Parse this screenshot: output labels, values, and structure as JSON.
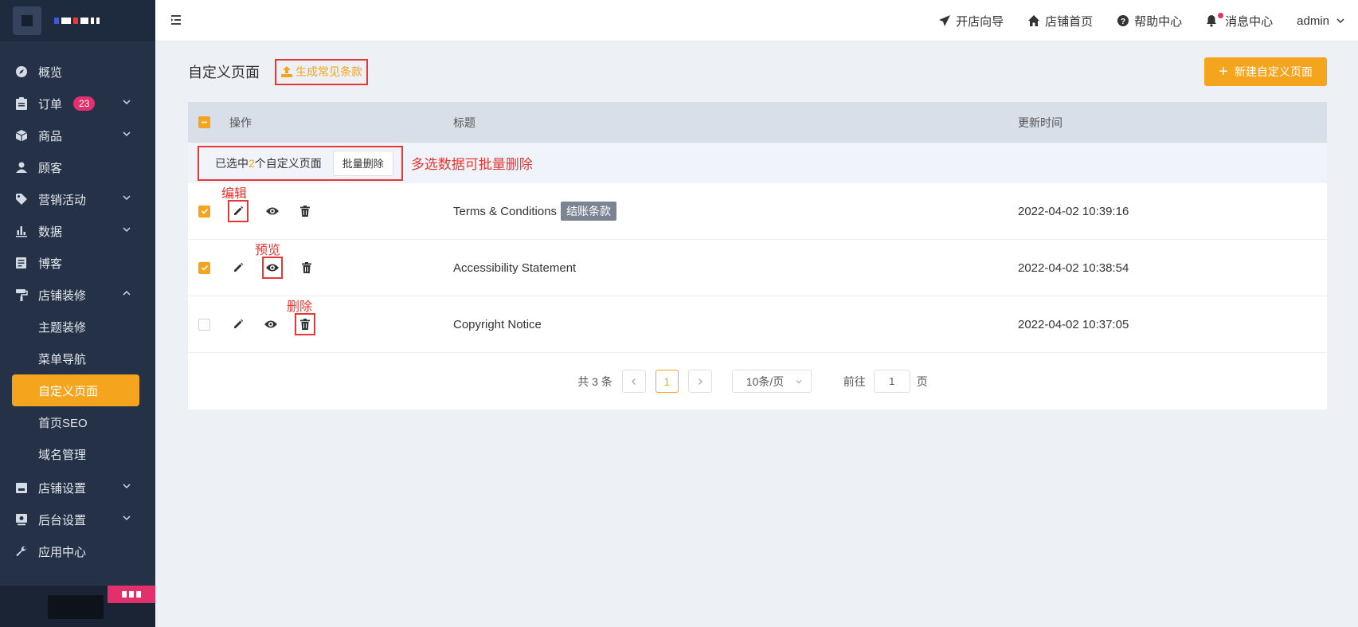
{
  "topbar": {
    "links": [
      {
        "label": "开店向导",
        "icon": "paper-plane-icon"
      },
      {
        "label": "店铺首页",
        "icon": "home-icon"
      },
      {
        "label": "帮助中心",
        "icon": "help-circle-icon"
      },
      {
        "label": "消息中心",
        "icon": "bell-icon"
      }
    ],
    "user": "admin"
  },
  "sidebar": {
    "items": [
      {
        "label": "概览",
        "icon": "compass-icon"
      },
      {
        "label": "订单",
        "icon": "clipboard-icon",
        "badge": "23"
      },
      {
        "label": "商品",
        "icon": "box-icon"
      },
      {
        "label": "顾客",
        "icon": "user-icon"
      },
      {
        "label": "营销活动",
        "icon": "tag-icon"
      },
      {
        "label": "数据",
        "icon": "bar-chart-icon"
      },
      {
        "label": "博客",
        "icon": "blog-icon"
      },
      {
        "label": "店铺装修",
        "icon": "paint-roller-icon"
      },
      {
        "label": "店铺设置",
        "icon": "store-icon"
      },
      {
        "label": "后台设置",
        "icon": "monitor-icon"
      },
      {
        "label": "应用中心",
        "icon": "wrench-icon"
      }
    ],
    "sub_items": [
      "主题装修",
      "菜单导航",
      "自定义页面",
      "首页SEO",
      "域名管理"
    ]
  },
  "page": {
    "title": "自定义页面",
    "generate_button": "生成常见条款",
    "new_button": "新建自定义页面"
  },
  "table": {
    "headers": {
      "op": "操作",
      "title": "标题",
      "time": "更新时间"
    },
    "bulk": {
      "prefix": "已选中",
      "count": "2",
      "suffix": "个自定义页面",
      "delete_button": "批量删除",
      "note": "多选数据可批量删除"
    },
    "rows": [
      {
        "title": "Terms & Conditions",
        "tag": "结账条款",
        "time": "2022-04-02 10:39:16",
        "checked": true,
        "note": "编辑"
      },
      {
        "title": "Accessibility Statement",
        "time": "2022-04-02 10:38:54",
        "checked": true,
        "note": "预览"
      },
      {
        "title": "Copyright Notice",
        "time": "2022-04-02 10:37:05",
        "checked": false,
        "note": "删除"
      }
    ]
  },
  "pagination": {
    "total": "共 3 条",
    "current": "1",
    "page_size": "10条/页",
    "goto_label": "前往",
    "goto_value": "1",
    "page_suffix": "页"
  },
  "colors": {
    "accent": "#f5a51d",
    "sidebar": "#243146",
    "annotation": "#e53935",
    "badge": "#e1306c"
  }
}
